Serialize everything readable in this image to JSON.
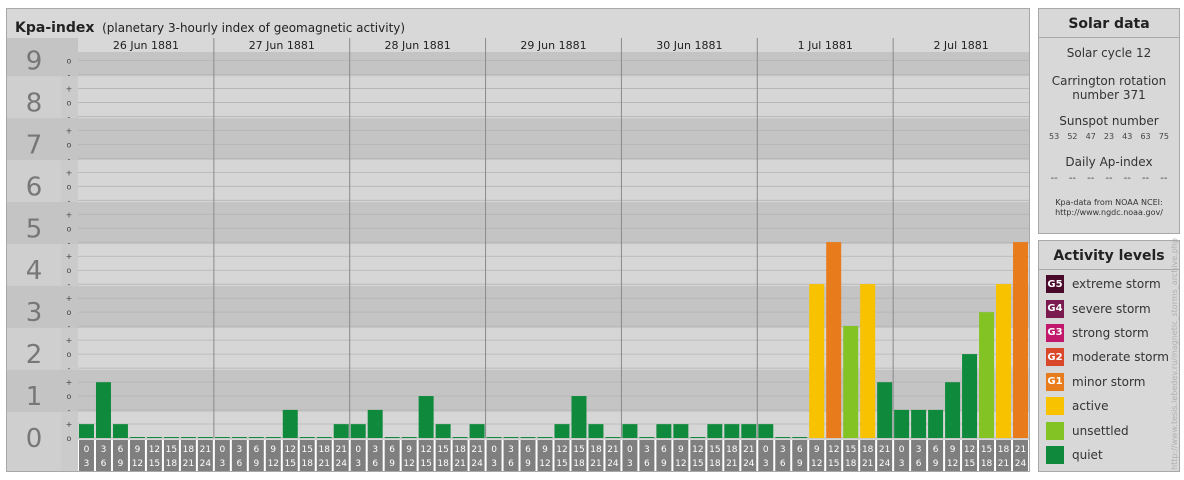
{
  "title": {
    "main": "Kpa-index",
    "sub": "(planetary 3-hourly index of geomagnetic activity)"
  },
  "colors": {
    "quiet": "#0f8a3c",
    "unsettled": "#84c324",
    "active": "#f8c200",
    "G1": "#e87c1c",
    "G2": "#d9482a",
    "G3": "#c2186b",
    "G4": "#7a1a4e",
    "G5": "#4a0a2a",
    "axis_band": "#7f7f7f"
  },
  "chart_data": {
    "type": "bar",
    "title": "Kpa-index",
    "subtitle": "(planetary 3-hourly index of geomagnetic activity)",
    "ylim": [
      0,
      9
    ],
    "y_ticks": [
      "0",
      "1",
      "2",
      "3",
      "4",
      "5",
      "6",
      "7",
      "8",
      "9"
    ],
    "minor_ticks": [
      "-",
      "o",
      "+"
    ],
    "days": [
      "26 Jun 1881",
      "27 Jun 1881",
      "28 Jun 1881",
      "29 Jun 1881",
      "30 Jun 1881",
      "1 Jul 1881",
      "2 Jul 1881"
    ],
    "interval_start_hours": [
      "0",
      "3",
      "6",
      "9",
      "12",
      "15",
      "18",
      "21"
    ],
    "interval_end_hours": [
      "3",
      "6",
      "9",
      "12",
      "15",
      "18",
      "21",
      "24"
    ],
    "values": [
      [
        0.33,
        1.33,
        0.33,
        0,
        0,
        0,
        0,
        0
      ],
      [
        0,
        0,
        0,
        0,
        0.67,
        0,
        0,
        0.33
      ],
      [
        0.33,
        0.67,
        0,
        0,
        1,
        0.33,
        0,
        0.33
      ],
      [
        0,
        0,
        0,
        0,
        0.33,
        1,
        0.33,
        0
      ],
      [
        0.33,
        0,
        0.33,
        0.33,
        0,
        0.33,
        0.33,
        0.33
      ],
      [
        0.33,
        0,
        0,
        3.67,
        4.67,
        2.67,
        3.67,
        1.33
      ],
      [
        0.67,
        0.67,
        0.67,
        1.33,
        2,
        3,
        3.67,
        4.67
      ]
    ]
  },
  "solar": {
    "title": "Solar data",
    "cycle": "Solar cycle 12",
    "carrington_line1": "Carrington rotation",
    "carrington_line2": "number 371",
    "sunspot_title": "Sunspot number",
    "sunspots": [
      "53",
      "52",
      "47",
      "23",
      "43",
      "63",
      "75"
    ],
    "ap_title": "Daily Ap-index",
    "ap_values": [
      "--",
      "--",
      "--",
      "--",
      "--",
      "--",
      "--"
    ],
    "source_line1": "Kpa-data from NOAA NCEI:",
    "source_line2": "http://www.ngdc.noaa.gov/"
  },
  "activity": {
    "title": "Activity levels",
    "levels": [
      {
        "code": "G5",
        "label": "extreme storm",
        "color": "#4a0a2a"
      },
      {
        "code": "G4",
        "label": "severe storm",
        "color": "#7a1a4e"
      },
      {
        "code": "G3",
        "label": "strong storm",
        "color": "#c2186b"
      },
      {
        "code": "G2",
        "label": "moderate storm",
        "color": "#d9482a"
      },
      {
        "code": "G1",
        "label": "minor storm",
        "color": "#e87c1c"
      },
      {
        "code": "",
        "label": "active",
        "color": "#f8c200"
      },
      {
        "code": "",
        "label": "unsettled",
        "color": "#84c324"
      },
      {
        "code": "",
        "label": "quiet",
        "color": "#0f8a3c"
      }
    ]
  },
  "credit": "http://www.tesis.lebedev.ru/magnetic_storms_archive.php"
}
